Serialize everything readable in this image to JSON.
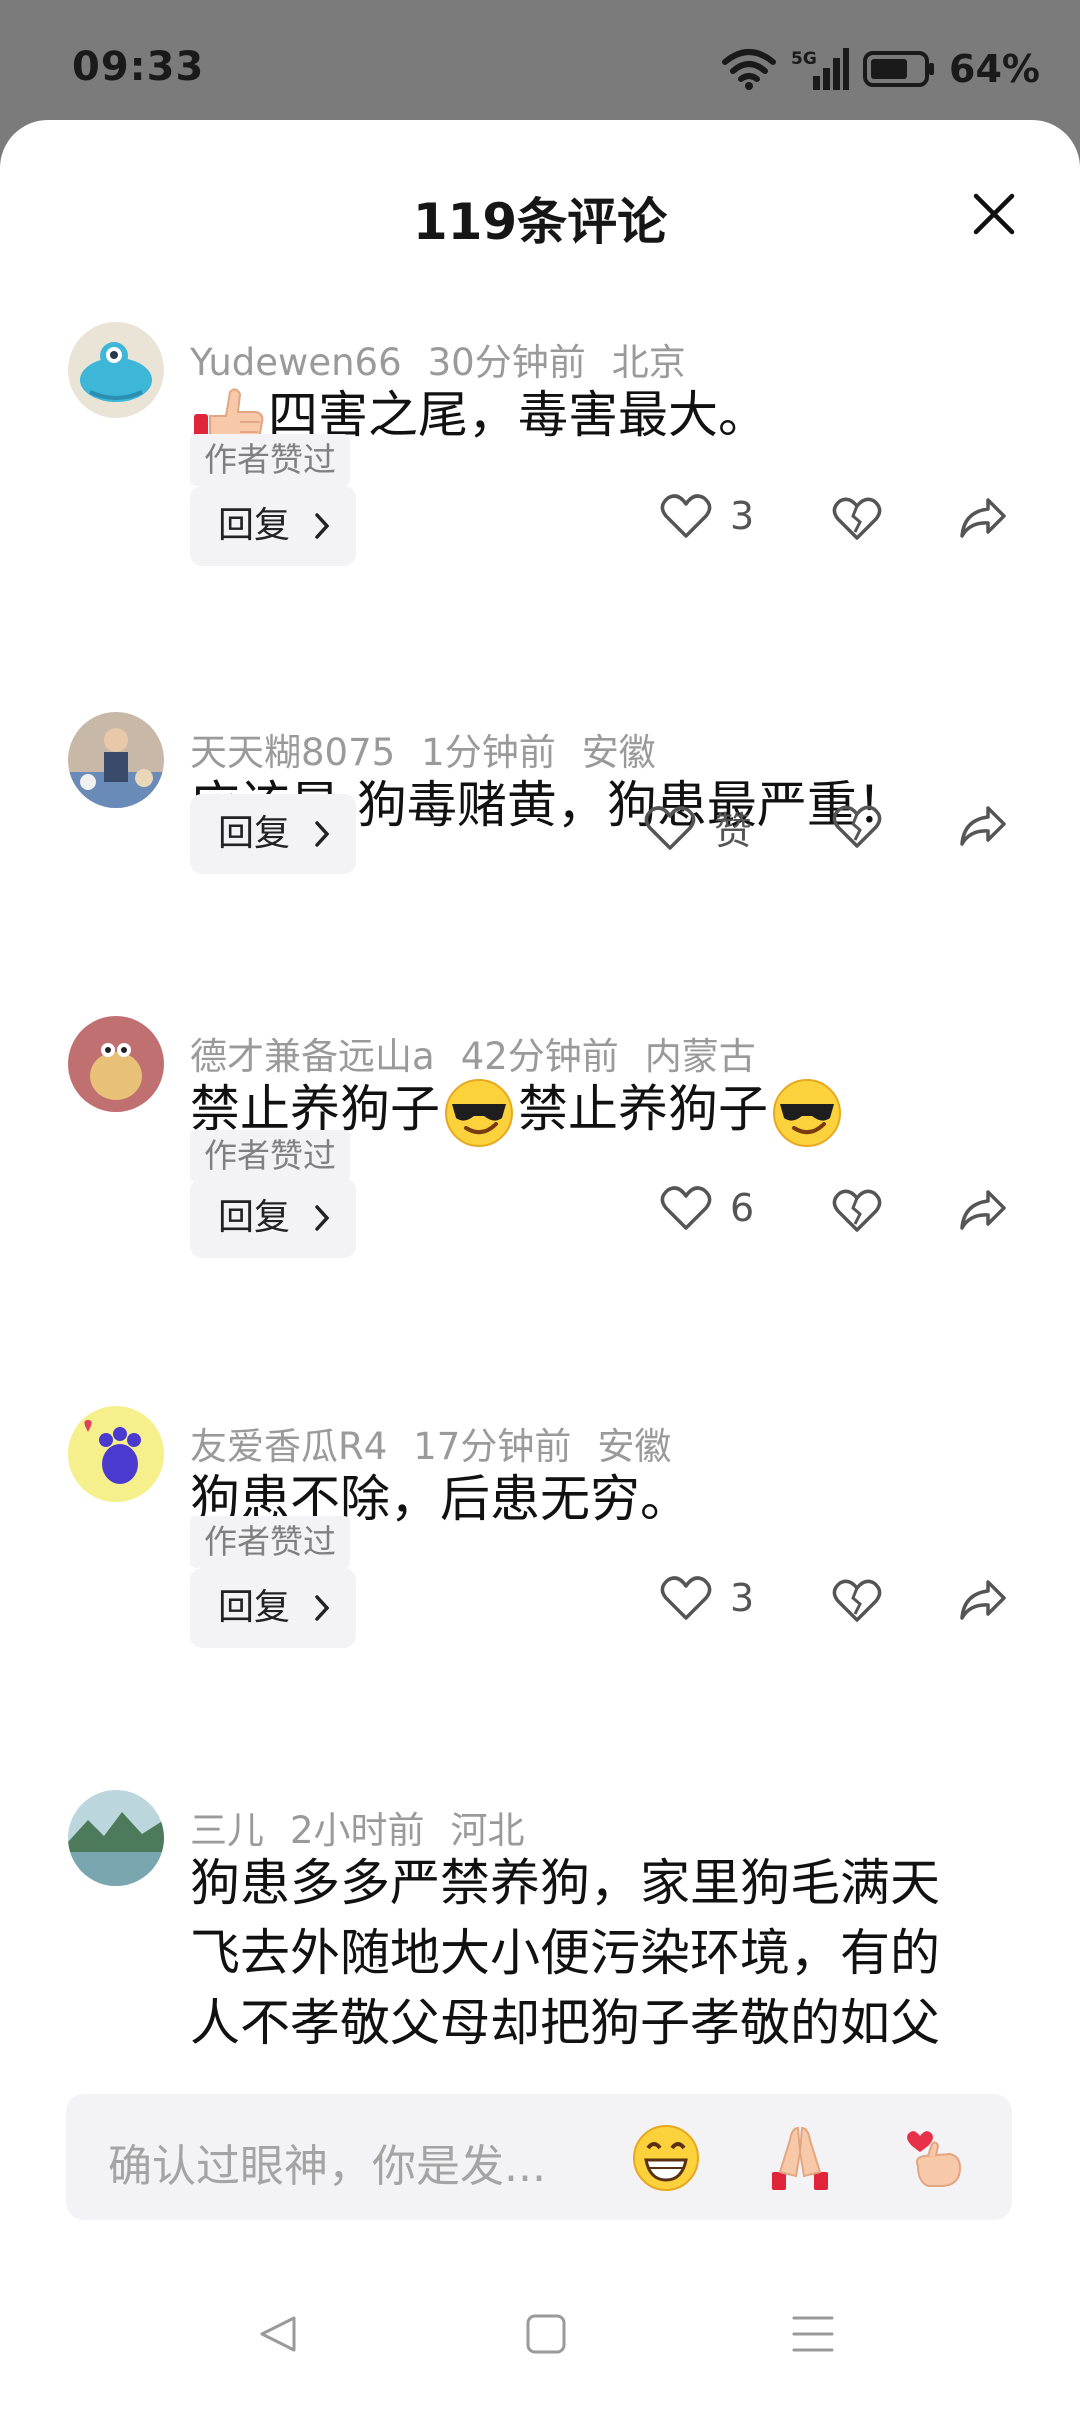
{
  "status_bar": {
    "time": "09:33",
    "network": "5G",
    "battery": "64%"
  },
  "sheet": {
    "title": "119条评论"
  },
  "comments": [
    {
      "user": "Yudewen66",
      "time": "30分钟前",
      "location": "北京",
      "text": "四害之尾，毒害最大。",
      "badge": "作者赞过",
      "reply": "回复",
      "likes": "3",
      "emoji": "thumbs-up"
    },
    {
      "user": "天天糊8075",
      "time": "1分钟前",
      "location": "安徽",
      "text": "应该是:狗毒赌黄，狗患最严重！",
      "reply": "回复",
      "likes": "赞"
    },
    {
      "user": "德才兼备远山a",
      "time": "42分钟前",
      "location": "内蒙古",
      "text_parts": [
        "禁止养狗子",
        "禁止养狗子"
      ],
      "badge": "作者赞过",
      "reply": "回复",
      "likes": "6",
      "emoji": "sunglasses-face"
    },
    {
      "user": "友爱香瓜R4",
      "time": "17分钟前",
      "location": "安徽",
      "text": "狗患不除，后患无穷。",
      "badge": "作者赞过",
      "reply": "回复",
      "likes": "3"
    },
    {
      "user": "三儿",
      "time": "2小时前",
      "location": "河北",
      "text_lines": [
        "狗患多多严禁养狗，家里狗毛满天",
        "飞去外随地大小便污染环境，有的",
        "人不孝敬父母却把狗子孝敬的如父"
      ]
    }
  ],
  "input": {
    "placeholder": "确认过眼神，你是发...",
    "emojis": [
      "grinning-face",
      "folded-hands",
      "finger-heart"
    ]
  },
  "nav": {
    "buttons": [
      "back-triangle",
      "home-square",
      "menu-lines"
    ]
  }
}
